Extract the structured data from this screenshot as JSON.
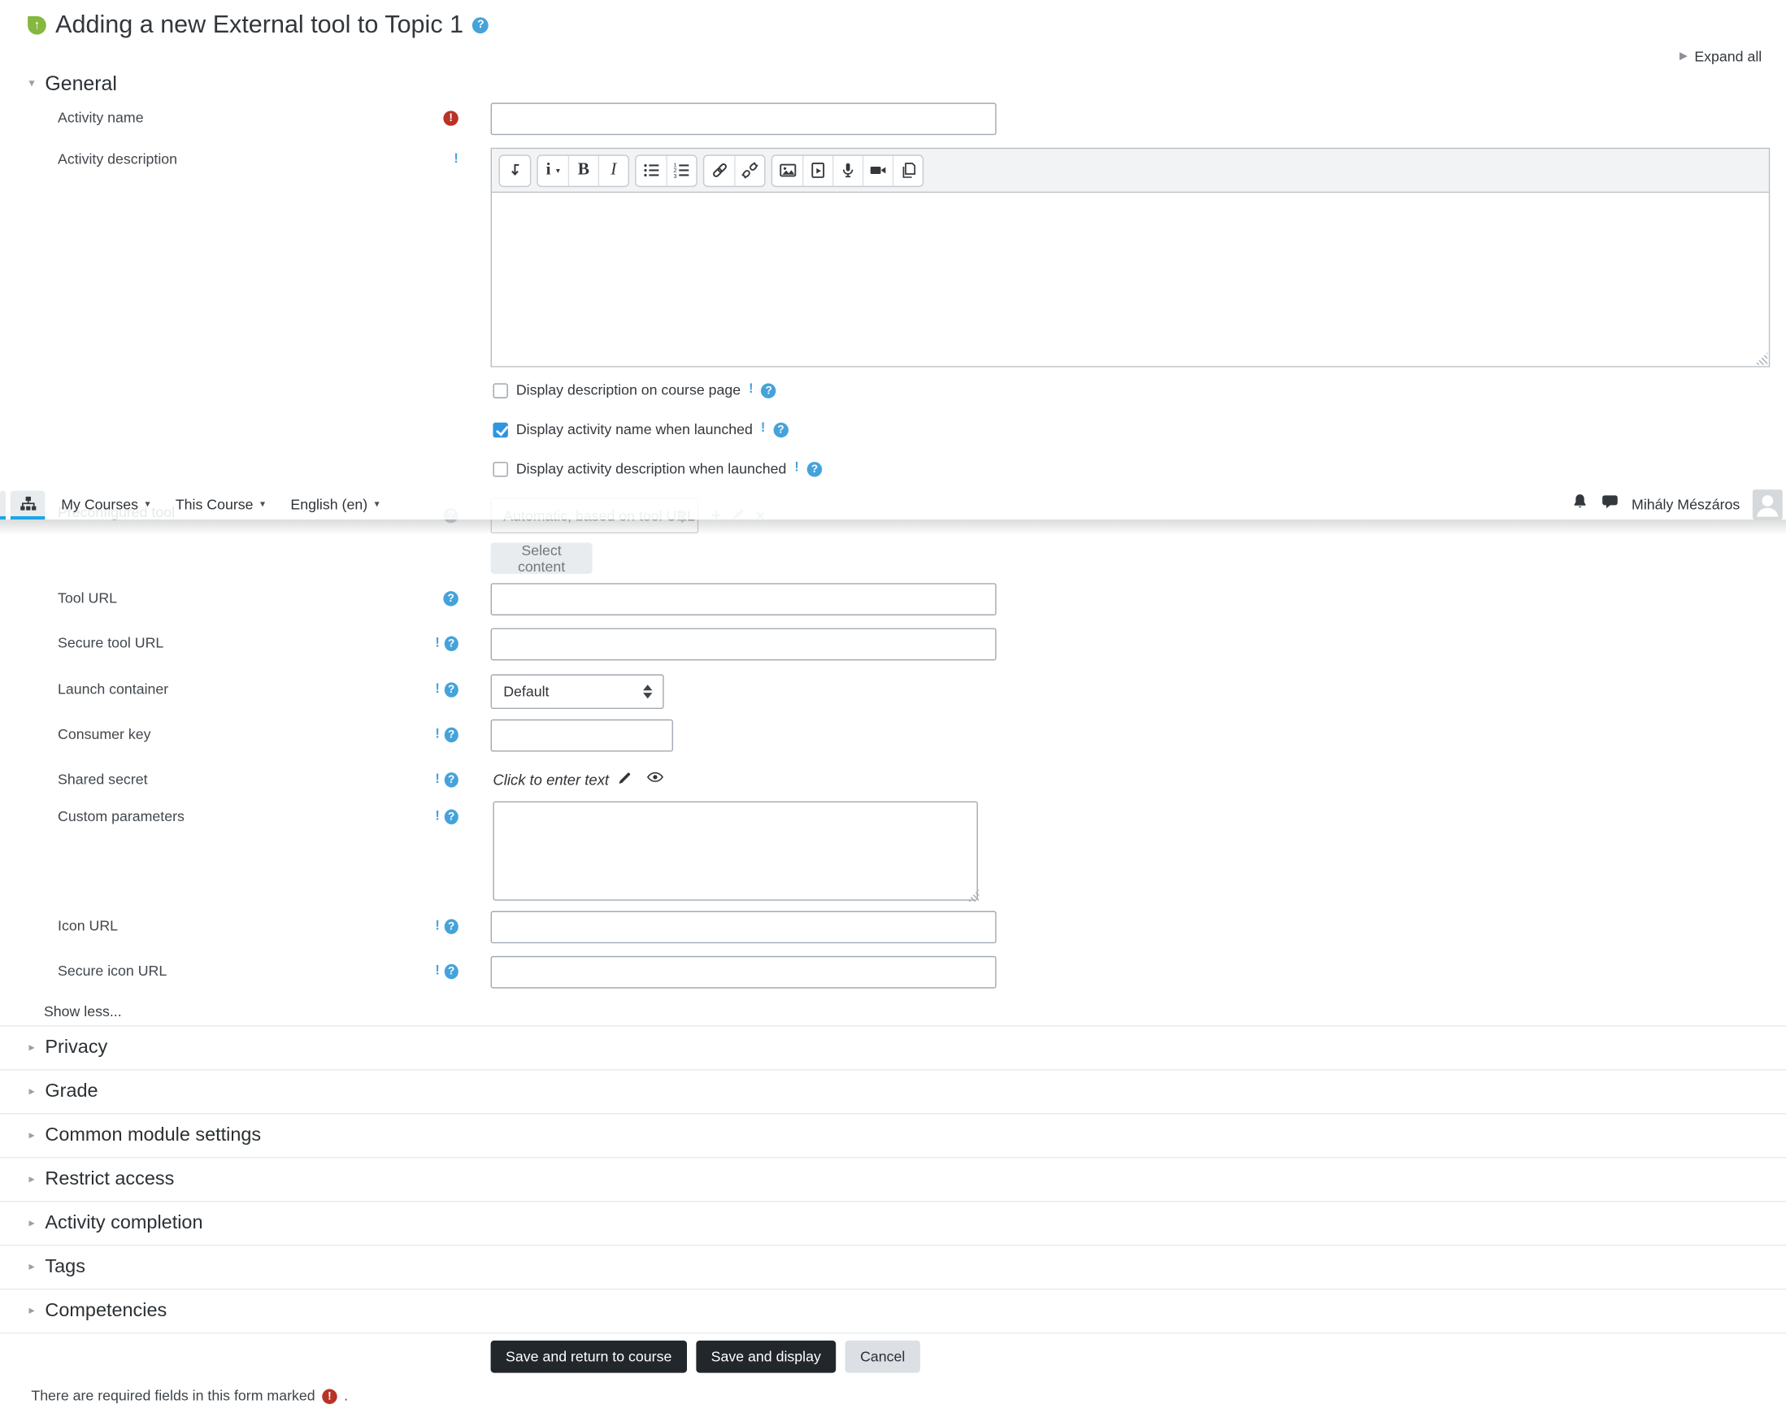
{
  "header": {
    "title": "Adding a new External tool to Topic 1",
    "expand_all": "Expand all"
  },
  "navbar": {
    "menus": [
      {
        "label": "My Courses"
      },
      {
        "label": "This Course"
      },
      {
        "label": "English (en)"
      }
    ],
    "user_name": "Mihály Mészáros"
  },
  "general": {
    "heading": "General"
  },
  "form": {
    "activity_name": {
      "label": "Activity name",
      "value": "",
      "required": true
    },
    "activity_description": {
      "label": "Activity description",
      "value": ""
    },
    "checkboxes": [
      {
        "label": "Display description on course page",
        "checked": false
      },
      {
        "label": "Display activity name when launched",
        "checked": true
      },
      {
        "label": "Display activity description when launched",
        "checked": false
      }
    ],
    "preconfigured_tool": {
      "label": "Preconfigured tool",
      "value": "Automatic, based on tool URL",
      "disabled": true
    },
    "select_content_label": "Select content",
    "tool_url": {
      "label": "Tool URL",
      "value": ""
    },
    "secure_tool_url": {
      "label": "Secure tool URL",
      "value": ""
    },
    "launch_container": {
      "label": "Launch container",
      "value": "Default"
    },
    "consumer_key": {
      "label": "Consumer key",
      "value": ""
    },
    "shared_secret": {
      "label": "Shared secret",
      "value": "Click to enter text"
    },
    "custom_parameters": {
      "label": "Custom parameters",
      "value": ""
    },
    "icon_url": {
      "label": "Icon URL",
      "value": ""
    },
    "secure_icon_url": {
      "label": "Secure icon URL",
      "value": ""
    },
    "show_less": "Show less..."
  },
  "collapsed_sections": [
    {
      "label": "Privacy"
    },
    {
      "label": "Grade"
    },
    {
      "label": "Common module settings"
    },
    {
      "label": "Restrict access"
    },
    {
      "label": "Activity completion"
    },
    {
      "label": "Tags"
    },
    {
      "label": "Competencies"
    }
  ],
  "actions": {
    "save_return": "Save and return to course",
    "save_display": "Save and display",
    "cancel": "Cancel"
  },
  "footer": {
    "required_note": "There are required fields in this form marked",
    "suffix": "."
  },
  "icons": {
    "title": "external-tool-icon",
    "help": "help-icon",
    "required": "required-icon",
    "editor_toolbar": [
      [
        "collapse-toolbar-icon"
      ],
      [
        "paragraph-styles-icon",
        "bold-icon",
        "italic-icon"
      ],
      [
        "unordered-list-icon",
        "ordered-list-icon"
      ],
      [
        "link-icon",
        "unlink-icon"
      ],
      [
        "insert-image-icon",
        "insert-media-icon",
        "record-audio-icon",
        "record-video-icon",
        "manage-files-icon"
      ]
    ],
    "navbar": [
      "sitemap-icon",
      "caret-down-icon",
      "notifications-bell-icon",
      "messages-icon",
      "avatar"
    ],
    "shared_secret": [
      "pencil-icon",
      "eye-icon"
    ],
    "preconfigured_actions": [
      "add-icon",
      "edit-icon",
      "delete-icon"
    ]
  },
  "colors": {
    "help_blue": "#45a3da",
    "required_red": "#b93226",
    "checkbox_checked": "#2e96e1",
    "tab_underline": "#19a7e8",
    "primary_button": "#22272c",
    "cancel_button": "#dcdfe3",
    "select_content_bg": "#e9ecef"
  }
}
